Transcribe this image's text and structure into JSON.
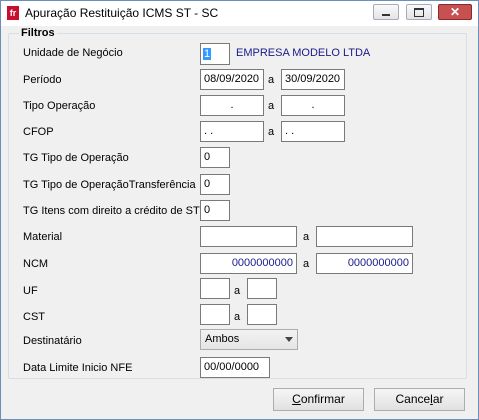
{
  "window": {
    "title": "Apuração Restituição ICMS ST - SC",
    "app_icon_text": "fr",
    "close_glyph": "✕"
  },
  "filters": {
    "legend": "Filtros",
    "unidade": {
      "label": "Unidade de Negócio",
      "code": "1",
      "name": "EMPRESA MODELO LTDA"
    },
    "periodo": {
      "label": "Período",
      "from": "08/09/2020",
      "sep": "a",
      "to": "30/09/2020"
    },
    "tipo_operacao": {
      "label": "Tipo Operação",
      "from": ".",
      "sep": "a",
      "to": "."
    },
    "cfop": {
      "label": "CFOP",
      "from": ". .",
      "sep": "a",
      "to": ". ."
    },
    "tg_tipo_operacao": {
      "label": "TG Tipo de Operação",
      "value": "0"
    },
    "tg_tipo_operacao_transf": {
      "label": "TG Tipo de OperaçãoTransferência",
      "value": "0"
    },
    "tg_itens_credito": {
      "label": "TG Itens com direito a crédito de ST",
      "value": "0"
    },
    "material": {
      "label": "Material",
      "from": "",
      "sep": "a",
      "to": ""
    },
    "ncm": {
      "label": "NCM",
      "from": "0000000000",
      "sep": "a",
      "to": "0000000000"
    },
    "uf": {
      "label": "UF",
      "from": "",
      "sep": "a",
      "to": ""
    },
    "cst": {
      "label": "CST",
      "from": "",
      "sep": "a",
      "to": ""
    },
    "destinatario": {
      "label": "Destinatário",
      "value": "Ambos"
    },
    "data_limite": {
      "label": "Data Limite Inicio NFE",
      "value": "00/00/0000"
    }
  },
  "buttons": {
    "confirm": {
      "label_first": "C",
      "label_rest": "onfirmar"
    },
    "cancel": {
      "label_pre": "Cance",
      "label_u": "l",
      "label_post": "ar"
    }
  }
}
